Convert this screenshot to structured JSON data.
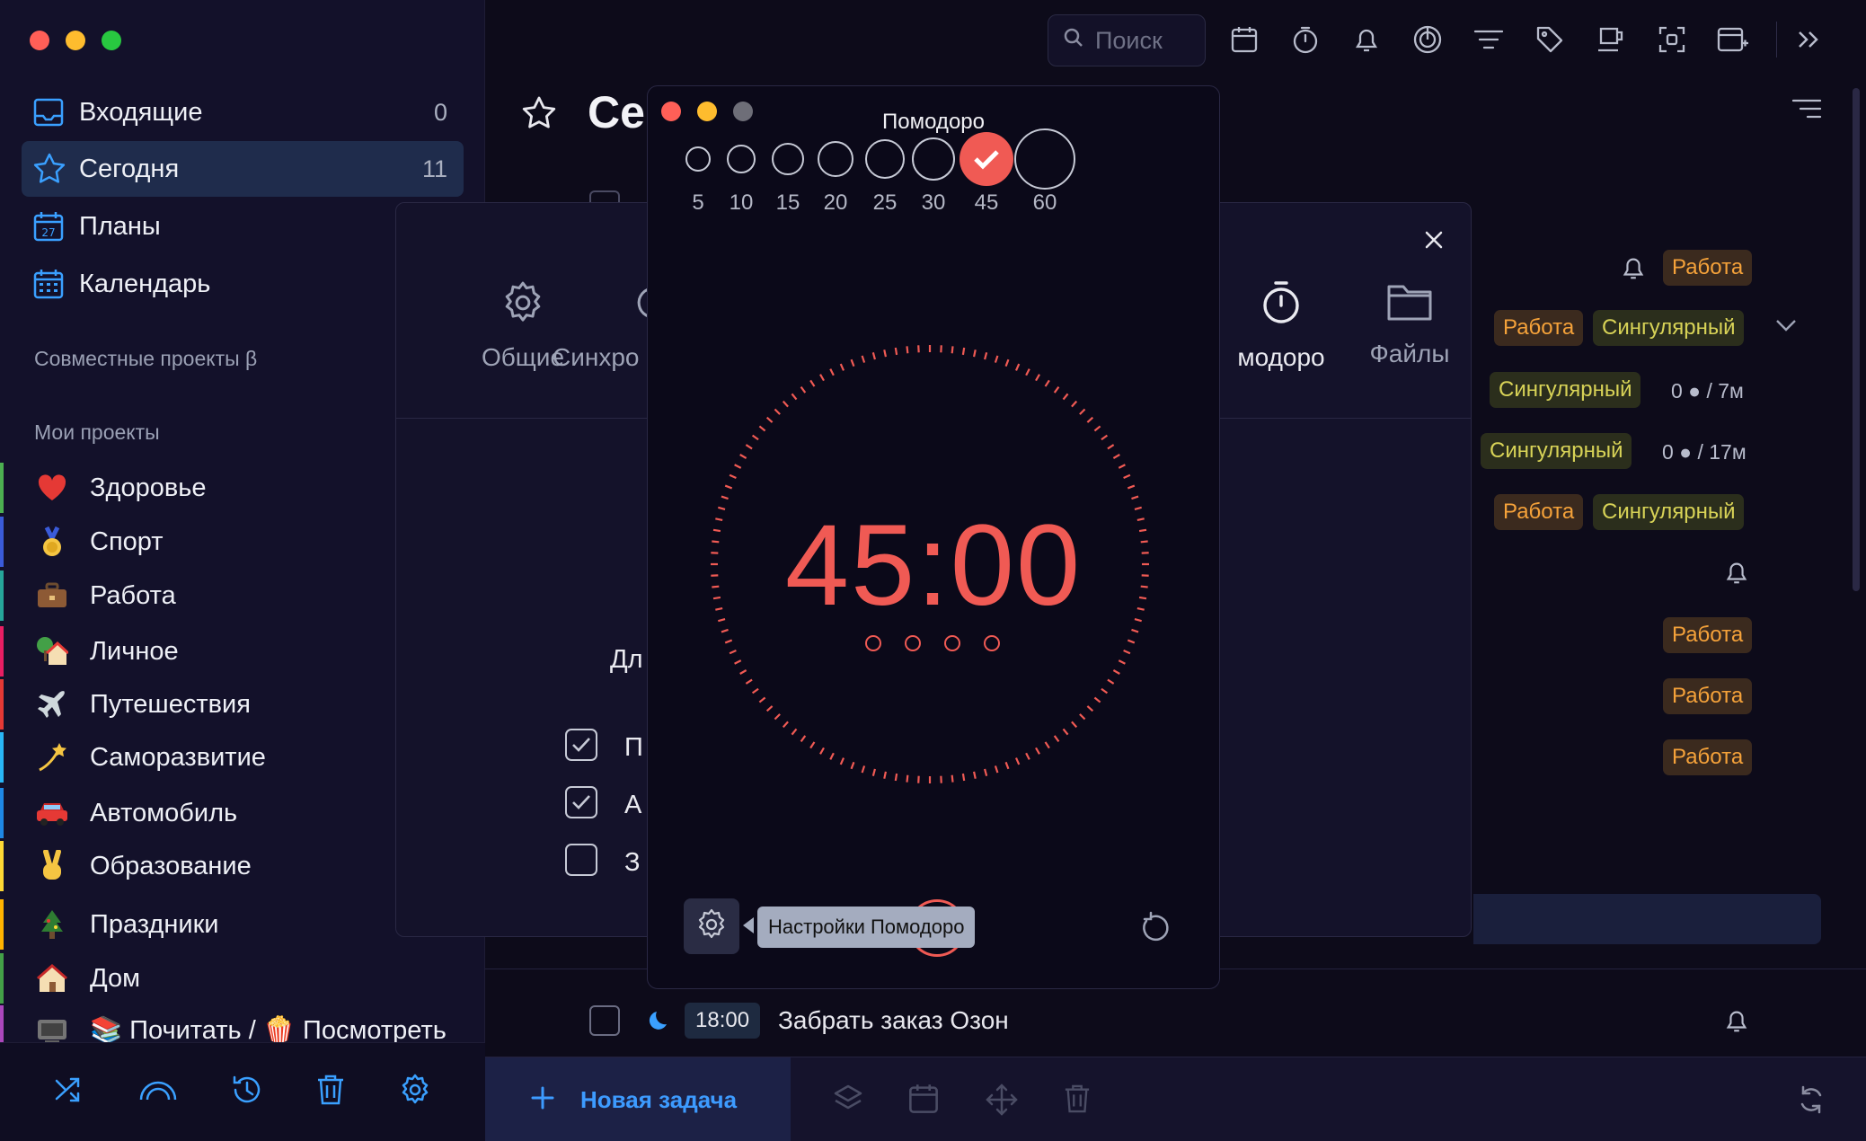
{
  "sidebar": {
    "nav": [
      {
        "label": "Входящие",
        "count": "0",
        "icon": "inbox-icon"
      },
      {
        "label": "Сегодня",
        "count": "11",
        "icon": "star-icon"
      },
      {
        "label": "Планы",
        "count": "",
        "icon": "calendar-27-icon"
      },
      {
        "label": "Календарь",
        "count": "",
        "icon": "calendar-grid-icon"
      }
    ],
    "shared_title": "Совместные проекты β",
    "my_title": "Мои проекты",
    "projects": [
      {
        "label": "Здоровье",
        "emoji": "heart-icon",
        "color": "#4caf50"
      },
      {
        "label": "Спорт",
        "emoji": "medal-icon",
        "color": "#3a5bd9"
      },
      {
        "label": "Работа",
        "emoji": "briefcase-icon",
        "color": "#26a69a"
      },
      {
        "label": "Личное",
        "emoji": "house-tree-icon",
        "color": "#e91e63"
      },
      {
        "label": "Путешествия",
        "emoji": "airplane-icon",
        "color": "#e53935"
      },
      {
        "label": "Саморазвитие",
        "emoji": "dizzy-star-icon",
        "color": "#29b6f6"
      },
      {
        "label": "Автомобиль",
        "emoji": "car-icon",
        "color": "#1e88e5"
      },
      {
        "label": "Образование",
        "emoji": "victory-hand-icon",
        "color": "#fdd835"
      },
      {
        "label": "Праздники",
        "emoji": "christmas-tree-icon",
        "color": "#ffb300"
      },
      {
        "label": "Дом",
        "emoji": "house-icon",
        "color": "#43a047"
      },
      {
        "label": "📚 Почитать / 🍿 Посмотреть",
        "emoji": "tv-icon",
        "color": "#ab47bc"
      }
    ],
    "footer_icons": [
      "shuffle-icon",
      "rainbow-icon",
      "history-icon",
      "trash-icon",
      "gear-icon"
    ]
  },
  "toolbar": {
    "search_placeholder": "Поиск",
    "icons": [
      "calendar-icon",
      "timer-icon",
      "bell-icon",
      "focus-icon",
      "filter-icon",
      "tag-icon",
      "cup-icon",
      "screenshot-icon",
      "add-window-icon",
      "chevron-double-right-icon"
    ]
  },
  "main": {
    "title": "Се",
    "tags": {
      "work": "Работа",
      "sing": "Сингулярный"
    },
    "meta_7m": "0 ● / 7м",
    "meta_17m": "0 ● / 17м",
    "task": {
      "time": "18:00",
      "title": "Забрать заказ Озон"
    },
    "new_task": "Новая задача"
  },
  "settings": {
    "tabs": [
      "Общие",
      "Синхро",
      "модоро",
      "Файлы"
    ],
    "partial_text": "Дл",
    "checkbox_rows": [
      {
        "label": "П",
        "checked": true
      },
      {
        "label": "А",
        "checked": true
      },
      {
        "label": "З",
        "checked": false
      }
    ]
  },
  "pomodoro": {
    "title": "Помодоро",
    "options": [
      "5",
      "10",
      "15",
      "20",
      "25",
      "30",
      "45",
      "60"
    ],
    "selected": "45",
    "time": "45:00",
    "cycles_total": 4,
    "tooltip": "Настройки Помодоро",
    "accent": "#f05a54"
  }
}
